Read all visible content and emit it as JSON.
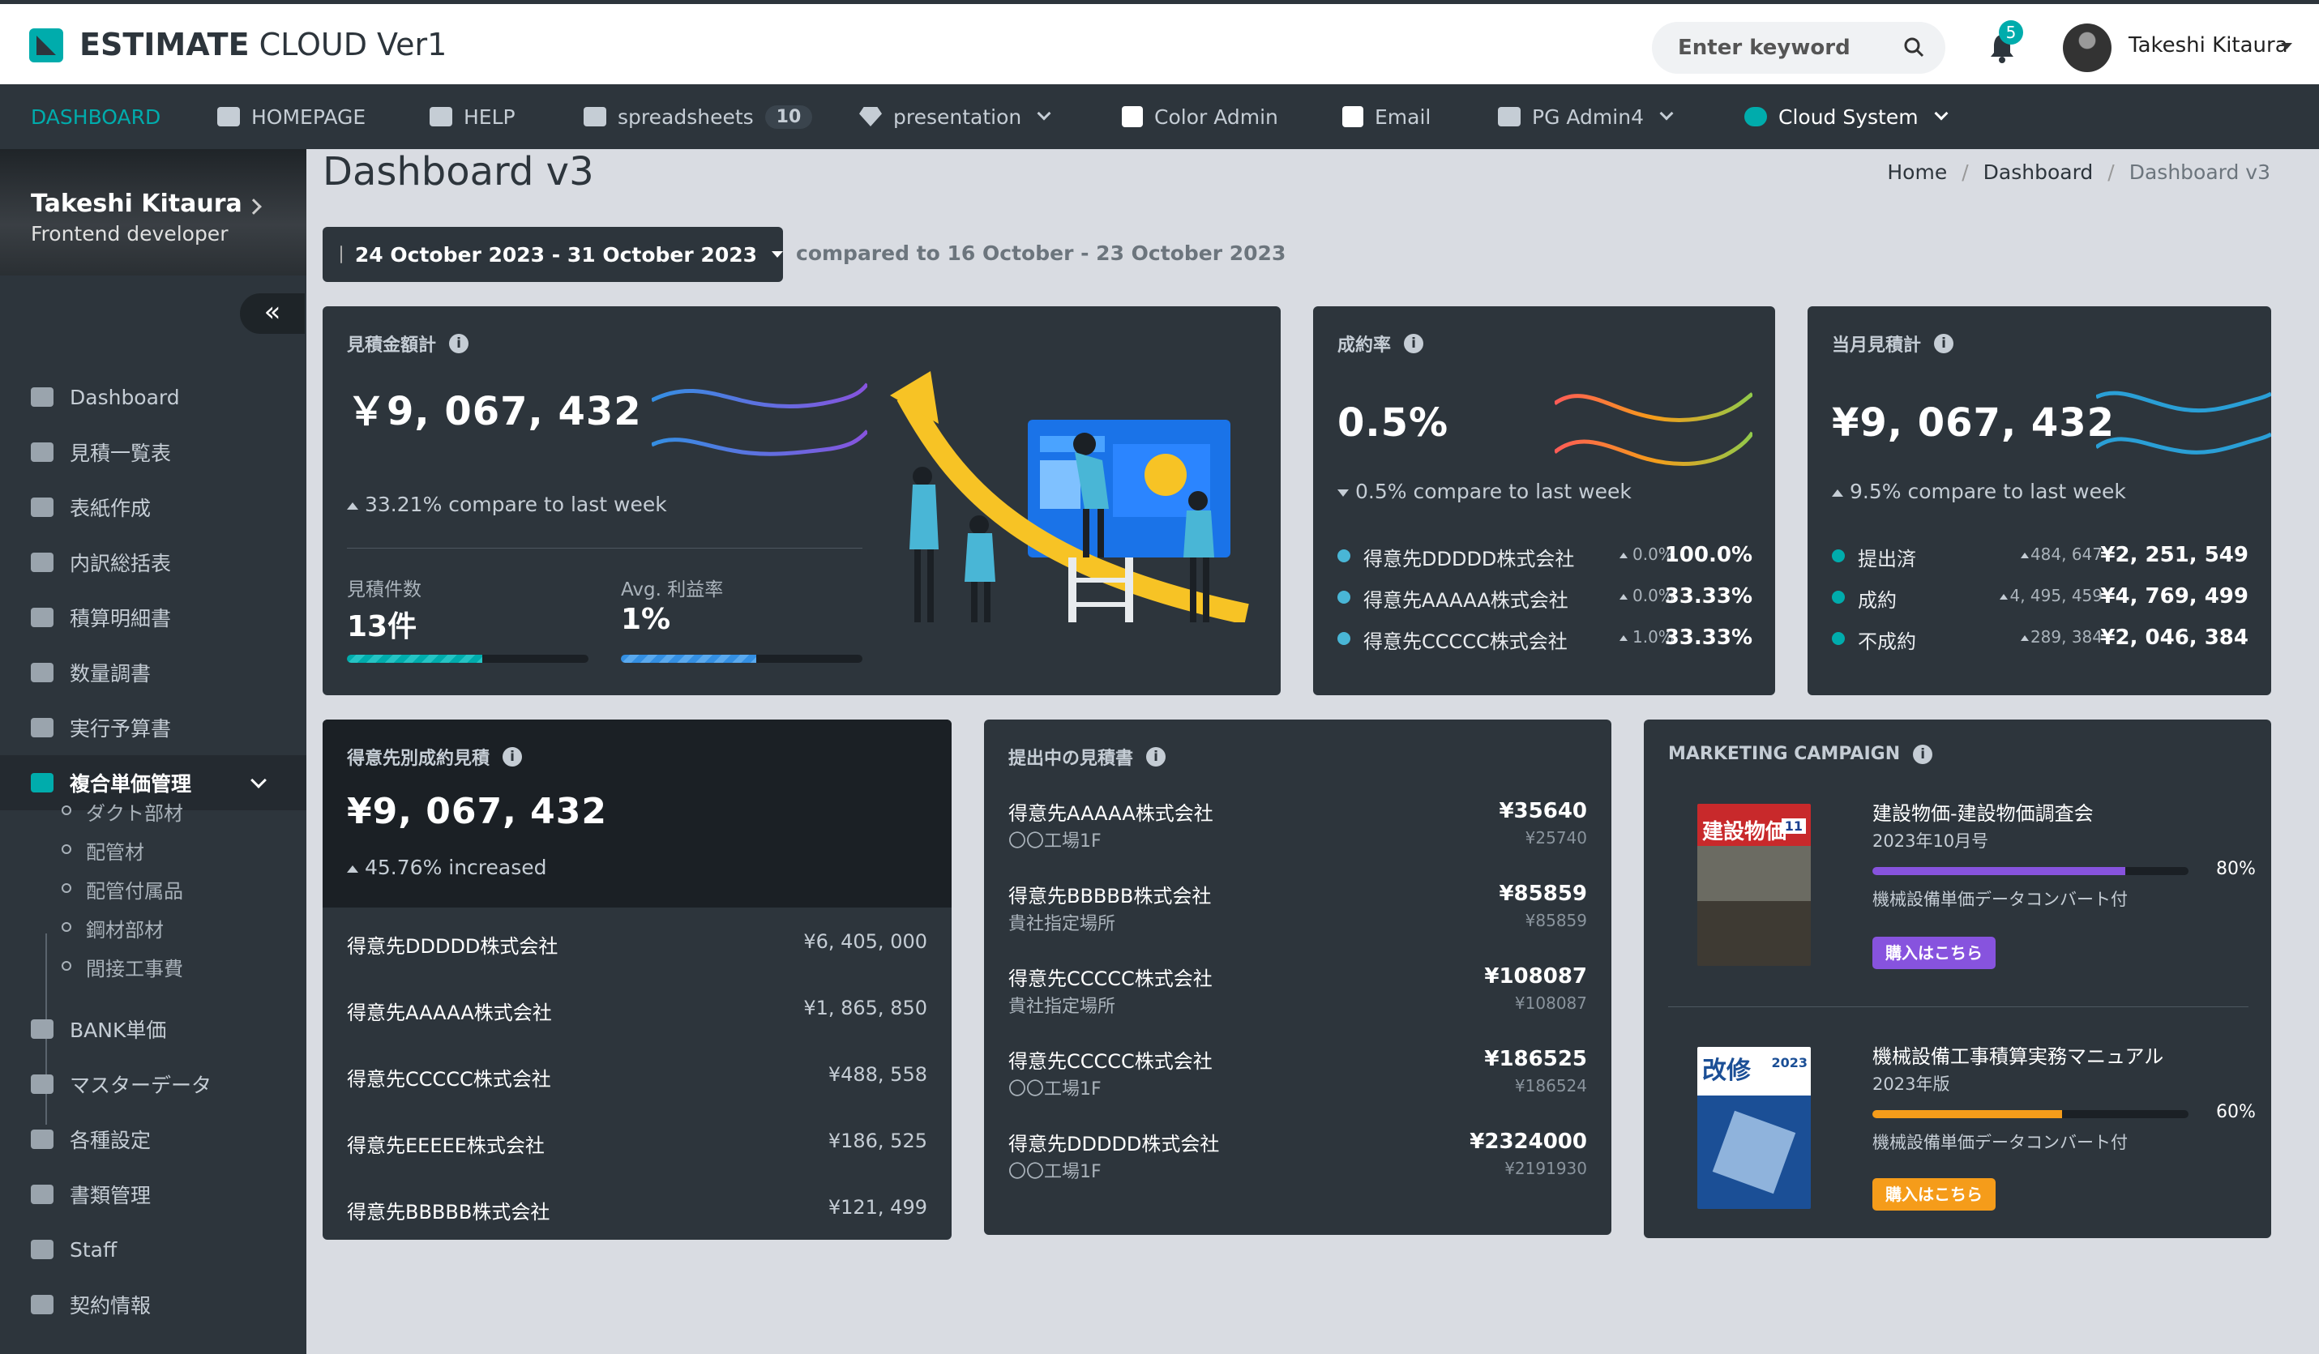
{
  "app": {
    "brand_bold": "ESTIMATE",
    "brand_rest": " CLOUD Ver1"
  },
  "header": {
    "search_placeholder": "Enter keyword",
    "notification_count": "5",
    "user_name": "Takeshi Kitaura"
  },
  "nav": [
    {
      "label": "DASHBOARD",
      "icon": "none",
      "active": true
    },
    {
      "label": "HOMEPAGE",
      "icon": "home-icon"
    },
    {
      "label": "HELP",
      "icon": "help-icon"
    },
    {
      "label": "spreadsheets",
      "icon": "spreadsheet-icon",
      "badge": "10"
    },
    {
      "label": "presentation",
      "icon": "diamond-icon",
      "dropdown": true
    },
    {
      "label": "Color Admin",
      "icon": "bootstrap-icon"
    },
    {
      "label": "Email",
      "icon": "bootstrap-icon"
    },
    {
      "label": "PG Admin4",
      "icon": "envelope-icon",
      "dropdown": true
    },
    {
      "label": "Cloud System",
      "icon": "cogs-icon",
      "dropdown": true
    }
  ],
  "sidebar": {
    "profile_name": "Takeshi Kitaura",
    "profile_role": "Frontend developer",
    "collapse_label": "«",
    "items": [
      "Dashboard",
      "見積一覧表",
      "表紙作成",
      "内訳総括表",
      "積算明細書",
      "数量調書",
      "実行予算書",
      "複合単価管理",
      "BANK単価",
      "マスターデータ",
      "各種設定",
      "書類管理",
      "Staff",
      "契約情報"
    ],
    "subitems": [
      "ダクト部材",
      "配管材",
      "配管付属品",
      "鋼材部材",
      "間接工事費"
    ]
  },
  "page": {
    "title": "Dashboard v3",
    "breadcrumb": [
      "Home",
      "Dashboard",
      "Dashboard v3"
    ],
    "date_range": "24 October 2023 - 31 October 2023",
    "compared": "compared to 16 October - 23 October 2023"
  },
  "card_estimate": {
    "title": "見積金額計",
    "value": "￥9, 067, 432",
    "compare": "33.21% compare to last week",
    "count_label": "見積件数",
    "count_value": "13件",
    "count_progress": 0.56,
    "profit_label": "Avg. 利益率",
    "profit_value": "1%",
    "profit_progress": 0.56
  },
  "card_rate": {
    "title": "成約率",
    "value": "0.5%",
    "compare": "0.5% compare to last week",
    "rows": [
      {
        "name": "得意先DDDDD株式会社",
        "pct": "0.0%",
        "value": "100.0%"
      },
      {
        "name": "得意先AAAAA株式会社",
        "pct": "0.0%",
        "value": "33.33%"
      },
      {
        "name": "得意先CCCCC株式会社",
        "pct": "1.0%",
        "value": "33.33%"
      }
    ]
  },
  "card_month": {
    "title": "当月見積計",
    "value": "¥9, 067, 432",
    "compare": "9.5% compare to last week",
    "rows": [
      {
        "name": "提出済",
        "pct": "484, 647",
        "value": "¥2, 251, 549"
      },
      {
        "name": "成約",
        "pct": "4, 495, 459",
        "value": "¥4, 769, 499"
      },
      {
        "name": "不成約",
        "pct": "289, 384",
        "value": "¥2, 046, 384"
      }
    ]
  },
  "card_clients": {
    "title": "得意先別成約見積",
    "value": "¥9, 067, 432",
    "compare": "45.76% increased",
    "rows": [
      {
        "name": "得意先DDDDD株式会社",
        "value": "¥6, 405, 000"
      },
      {
        "name": "得意先AAAAA株式会社",
        "value": "¥1, 865, 850"
      },
      {
        "name": "得意先CCCCC株式会社",
        "value": "¥488, 558"
      },
      {
        "name": "得意先EEEEE株式会社",
        "value": "¥186, 525"
      },
      {
        "name": "得意先BBBBB株式会社",
        "value": "¥121, 499"
      }
    ]
  },
  "card_submitted": {
    "title": "提出中の見積書",
    "rows": [
      {
        "name": "得意先AAAAA株式会社",
        "sub": "〇〇工場1F",
        "amount": "¥35640",
        "base": "¥25740"
      },
      {
        "name": "得意先BBBBB株式会社",
        "sub": "貴社指定場所",
        "amount": "¥85859",
        "base": "¥85859"
      },
      {
        "name": "得意先CCCCC株式会社",
        "sub": "貴社指定場所",
        "amount": "¥108087",
        "base": "¥108087"
      },
      {
        "name": "得意先CCCCC株式会社",
        "sub": "〇〇工場1F",
        "amount": "¥186525",
        "base": "¥186524"
      },
      {
        "name": "得意先DDDDD株式会社",
        "sub": "〇〇工場1F",
        "amount": "¥2324000",
        "base": "¥2191930"
      }
    ]
  },
  "card_marketing": {
    "title": "MARKETING CAMPAIGN",
    "items": [
      {
        "title": "建設物価-建設物価調査会",
        "sub": "2023年10月号",
        "progress": 0.8,
        "pct": "80%",
        "note": "機械設備単価データコンバート付",
        "button": "購入はこちら",
        "color": "#8753de",
        "book_text": "建設物価",
        "book_badge": "11"
      },
      {
        "title": "機械設備工事積算実務マニュアル",
        "sub": "2023年版",
        "progress": 0.6,
        "pct": "60%",
        "note": "機械設備単価データコンバート付",
        "button": "購入はこちら",
        "color": "#f59c1a",
        "book_text": "改修",
        "book_badge": "2023"
      }
    ]
  },
  "colors": {
    "accent": "#00acac",
    "dark": "#2d353c",
    "purple": "#8753de",
    "orange": "#f59c1a",
    "info": "#49b6d6"
  }
}
